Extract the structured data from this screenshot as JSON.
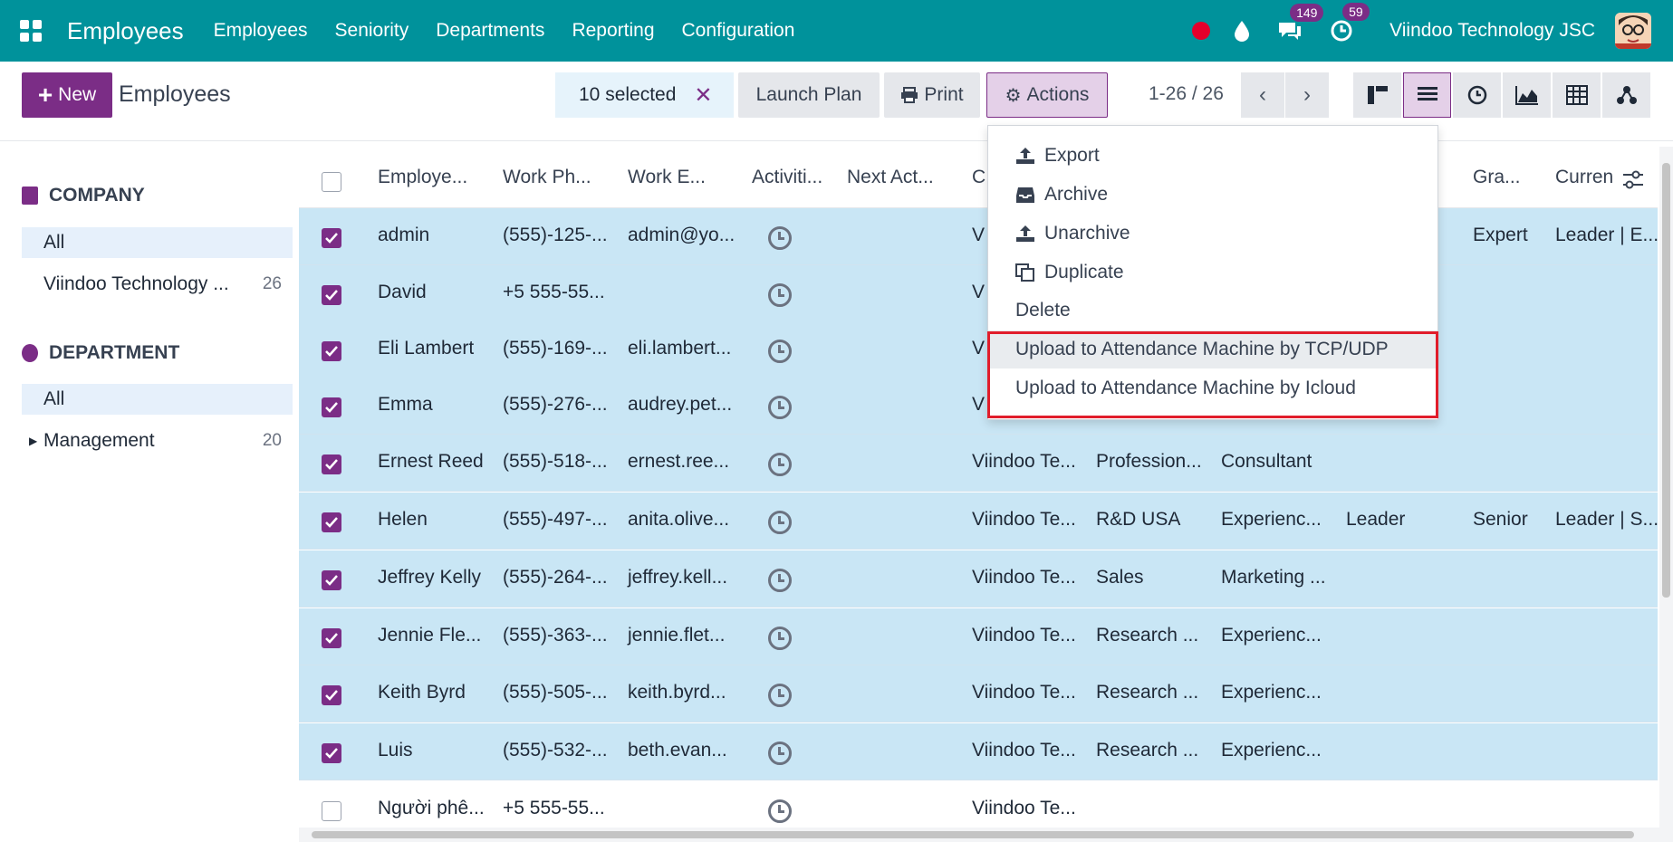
{
  "navbar": {
    "brand": "Employees",
    "menu": [
      "Employees",
      "Seniority",
      "Departments",
      "Reporting",
      "Configuration"
    ],
    "messages_count": "149",
    "activities_count": "59",
    "company": "Viindoo Technology JSC"
  },
  "control": {
    "new_label": "New",
    "page_title": "Employees",
    "selected_text": "10 selected",
    "launch_plan": "Launch Plan",
    "print": "Print",
    "actions": "Actions",
    "pager": "1-26 / 26"
  },
  "sidebar": {
    "company_title": "COMPANY",
    "company_items": [
      {
        "label": "All",
        "count": ""
      },
      {
        "label": "Viindoo Technology ...",
        "count": "26"
      }
    ],
    "department_title": "DEPARTMENT",
    "department_items": [
      {
        "label": "All",
        "count": ""
      },
      {
        "label": "Management",
        "count": "20"
      }
    ]
  },
  "table": {
    "headers": [
      "Employe...",
      "Work Ph...",
      "Work E...",
      "Activiti...",
      "Next Act...",
      "C",
      "Gra...",
      "Curren"
    ],
    "rows": [
      {
        "name": "admin",
        "phone": "(555)-125-...",
        "email": "admin@yo...",
        "company": "V",
        "dept": "",
        "job": "",
        "level": "",
        "grade": "Expert",
        "current": "Leader | E..."
      },
      {
        "name": "David",
        "phone": "+5 555-55...",
        "email": "",
        "company": "V",
        "dept": "",
        "job": "",
        "level": "",
        "grade": "",
        "current": ""
      },
      {
        "name": "Eli Lambert",
        "phone": "(555)-169-...",
        "email": "eli.lambert...",
        "company": "V",
        "dept": "",
        "job": "",
        "level": "",
        "grade": "",
        "current": ""
      },
      {
        "name": "Emma",
        "phone": "(555)-276-...",
        "email": "audrey.pet...",
        "company": "V",
        "dept": "",
        "job": "",
        "level": "",
        "grade": "",
        "current": ""
      },
      {
        "name": "Ernest Reed",
        "phone": "(555)-518-...",
        "email": "ernest.ree...",
        "company": "Viindoo Te...",
        "dept": "Profession...",
        "job": "Consultant",
        "level": "",
        "grade": "",
        "current": ""
      },
      {
        "name": "Helen",
        "phone": "(555)-497-...",
        "email": "anita.olive...",
        "company": "Viindoo Te...",
        "dept": "R&D USA",
        "job": "Experienc...",
        "level": "Leader",
        "grade": "Senior",
        "current": "Leader | S..."
      },
      {
        "name": "Jeffrey Kelly",
        "phone": "(555)-264-...",
        "email": "jeffrey.kell...",
        "company": "Viindoo Te...",
        "dept": "Sales",
        "job": "Marketing ...",
        "level": "",
        "grade": "",
        "current": ""
      },
      {
        "name": "Jennie Fle...",
        "phone": "(555)-363-...",
        "email": "jennie.flet...",
        "company": "Viindoo Te...",
        "dept": "Research ...",
        "job": "Experienc...",
        "level": "",
        "grade": "",
        "current": ""
      },
      {
        "name": "Keith Byrd",
        "phone": "(555)-505-...",
        "email": "keith.byrd...",
        "company": "Viindoo Te...",
        "dept": "Research ...",
        "job": "Experienc...",
        "level": "",
        "grade": "",
        "current": ""
      },
      {
        "name": "Luis",
        "phone": "(555)-532-...",
        "email": "beth.evan...",
        "company": "Viindoo Te...",
        "dept": "Research ...",
        "job": "Experienc...",
        "level": "",
        "grade": "",
        "current": ""
      },
      {
        "name": "Người phê...",
        "phone": "+5 555-55...",
        "email": "",
        "company": "Viindoo Te...",
        "dept": "",
        "job": "",
        "level": "",
        "grade": "",
        "current": ""
      }
    ]
  },
  "actions_menu": {
    "items": [
      "Export",
      "Archive",
      "Unarchive",
      "Duplicate",
      "Delete",
      "Upload to Attendance Machine by TCP/UDP",
      "Upload to Attendance Machine by Icloud"
    ]
  },
  "colors": {
    "navbar": "#00929b",
    "primary": "#7b2d86",
    "selected_row": "#c9e6f5",
    "highlight_box": "#e11d2b"
  }
}
